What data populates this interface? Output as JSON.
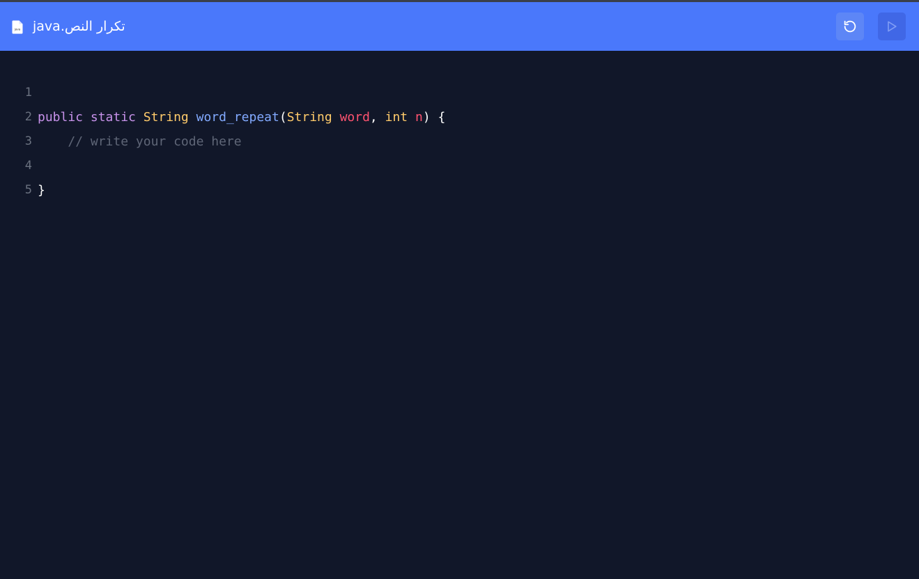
{
  "header": {
    "file_name": "تكرار النص.java",
    "file_icon": "java-file-icon",
    "file_icon_label": "java",
    "reset_button_icon": "reset-icon",
    "run_button_icon": "play-icon",
    "background_color": "#4a78fb"
  },
  "editor": {
    "background_color": "#111729",
    "lines": [
      {
        "number": "1",
        "tokens": {
          "public": "public",
          "static": "static",
          "string_type": "String",
          "method": "word_repeat",
          "open_paren": "(",
          "param_type": "String",
          "param1": "word",
          "comma": ",",
          "int_type": "int",
          "param2": "n",
          "close": ") {"
        }
      },
      {
        "number": "2",
        "text": "// write your code here"
      },
      {
        "number": "3",
        "text": ""
      },
      {
        "number": "4",
        "text": "}"
      },
      {
        "number": "5",
        "text": ""
      }
    ]
  }
}
